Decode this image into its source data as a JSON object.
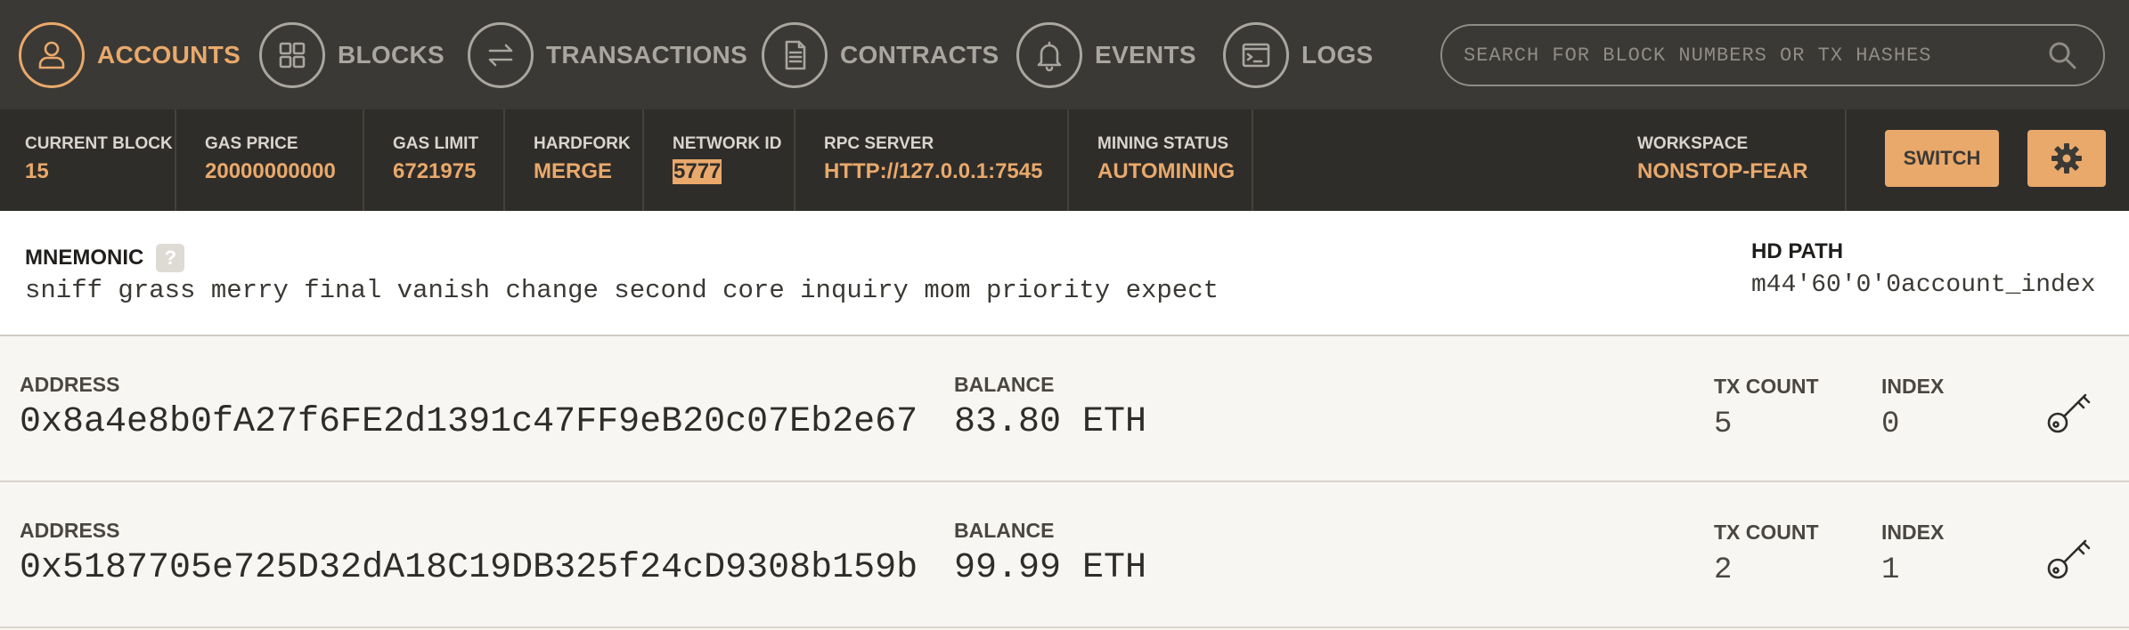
{
  "nav": {
    "items": [
      {
        "label": "ACCOUNTS",
        "icon": "person-icon",
        "active": true
      },
      {
        "label": "BLOCKS",
        "icon": "grid-icon",
        "active": false
      },
      {
        "label": "TRANSACTIONS",
        "icon": "swap-arrows-icon",
        "active": false
      },
      {
        "label": "CONTRACTS",
        "icon": "document-icon",
        "active": false
      },
      {
        "label": "EVENTS",
        "icon": "bell-icon",
        "active": false
      },
      {
        "label": "LOGS",
        "icon": "terminal-icon",
        "active": false
      }
    ],
    "search_placeholder": "SEARCH FOR BLOCK NUMBERS OR TX HASHES"
  },
  "status": {
    "current_block": {
      "label": "CURRENT BLOCK",
      "value": "15"
    },
    "gas_price": {
      "label": "GAS PRICE",
      "value": "20000000000"
    },
    "gas_limit": {
      "label": "GAS LIMIT",
      "value": "6721975"
    },
    "hardfork": {
      "label": "HARDFORK",
      "value": "MERGE"
    },
    "network_id": {
      "label": "NETWORK ID",
      "value": "5777"
    },
    "rpc_server": {
      "label": "RPC SERVER",
      "value": "HTTP://127.0.0.1:7545"
    },
    "mining_status": {
      "label": "MINING STATUS",
      "value": "AUTOMINING"
    },
    "workspace": {
      "label": "WORKSPACE",
      "value": "NONSTOP-FEAR"
    },
    "switch_label": "SWITCH"
  },
  "mnemonic": {
    "label": "MNEMONIC",
    "help": "?",
    "words": "sniff grass merry final vanish change second core inquiry mom priority expect",
    "hd_path_label": "HD PATH",
    "hd_path": "m44'60'0'0account_index"
  },
  "accounts": [
    {
      "address_label": "ADDRESS",
      "address": "0x8a4e8b0fA27f6FE2d1391c47FF9eB20c07Eb2e67",
      "balance_label": "BALANCE",
      "balance": "83.80 ETH",
      "tx_count_label": "TX COUNT",
      "tx_count": "5",
      "index_label": "INDEX",
      "index": "0"
    },
    {
      "address_label": "ADDRESS",
      "address": "0x5187705e725D32dA18C19DB325f24cD9308b159b",
      "balance_label": "BALANCE",
      "balance": "99.99 ETH",
      "tx_count_label": "TX COUNT",
      "tx_count": "2",
      "index_label": "INDEX",
      "index": "1"
    }
  ],
  "colors": {
    "accent": "#e9a96b",
    "nav_bg": "#3b3935",
    "status_bg": "#2f2d2a",
    "muted": "#a9a69f"
  }
}
